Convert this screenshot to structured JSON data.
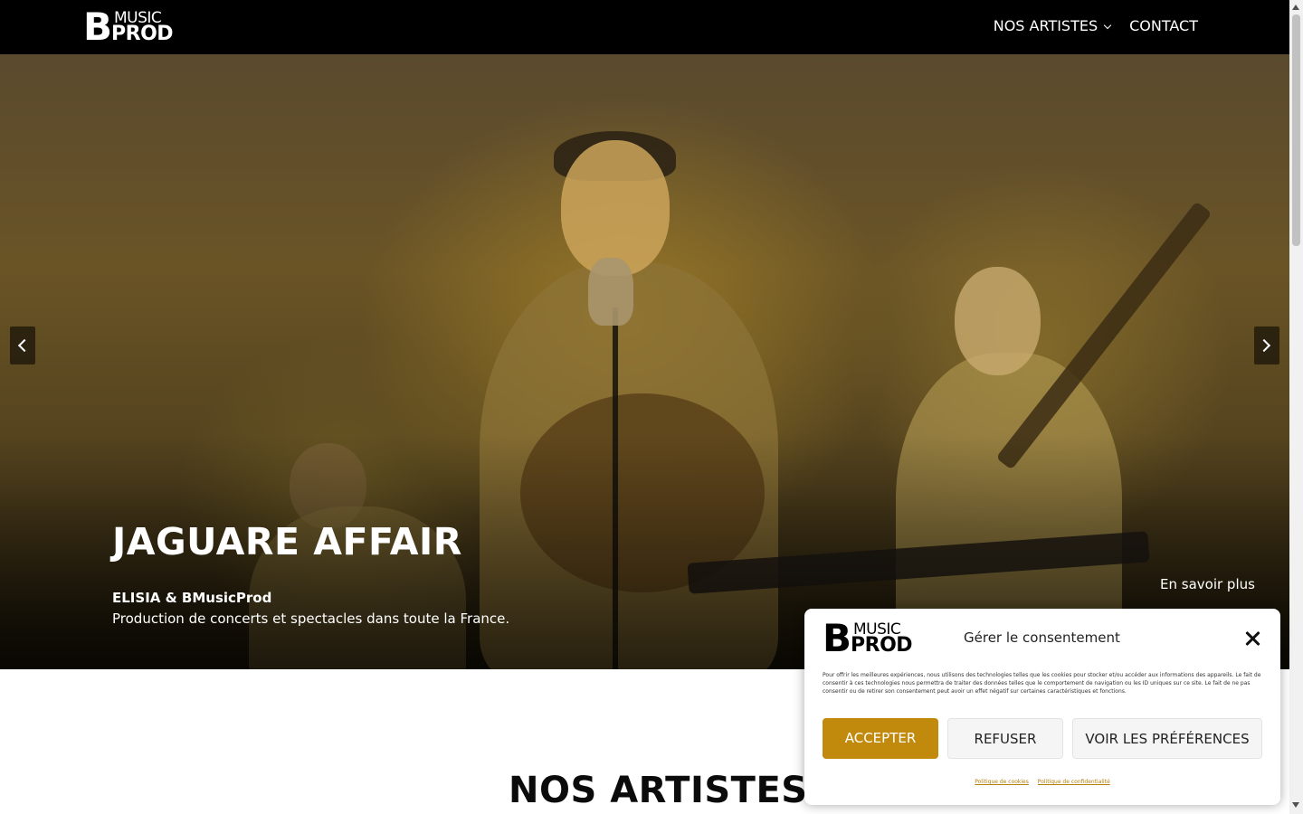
{
  "header": {
    "logo": {
      "b": "B",
      "music": "MUSIC",
      "prod": "PROD"
    },
    "nav": {
      "artists": "NOS ARTISTES",
      "contact": "CONTACT"
    }
  },
  "hero": {
    "title": "JAGUARE AFFAIR",
    "subtitle_bold": "ELISIA & BMusicProd",
    "subtitle": "Production de concerts et spectacles dans toute la France.",
    "cta": "En savoir plus",
    "icons": {
      "prev": "chevron-left-icon",
      "next": "chevron-right-icon"
    }
  },
  "section": {
    "title": "NOS ARTISTES"
  },
  "consent": {
    "logo": {
      "b": "B",
      "music": "MUSIC",
      "prod": "PROD"
    },
    "title": "Gérer le consentement",
    "body": "Pour offrir les meilleures expériences, nous utilisons des technologies telles que les cookies pour stocker et/ou accéder aux informations des appareils. Le fait de consentir à ces technologies nous permettra de traiter des données telles que le comportement de navigation ou les ID uniques sur ce site. Le fait de ne pas consentir ou de retirer son consentement peut avoir un effet négatif sur certaines caractéristiques et fonctions.",
    "accept": "ACCEPTER",
    "refuse": "REFUSER",
    "preferences": "VOIR LES PRÉFÉRENCES",
    "cookie_policy": "Politique de cookies",
    "privacy_policy": "Politique de confidentialité",
    "accent_color": "#c18a0c"
  }
}
